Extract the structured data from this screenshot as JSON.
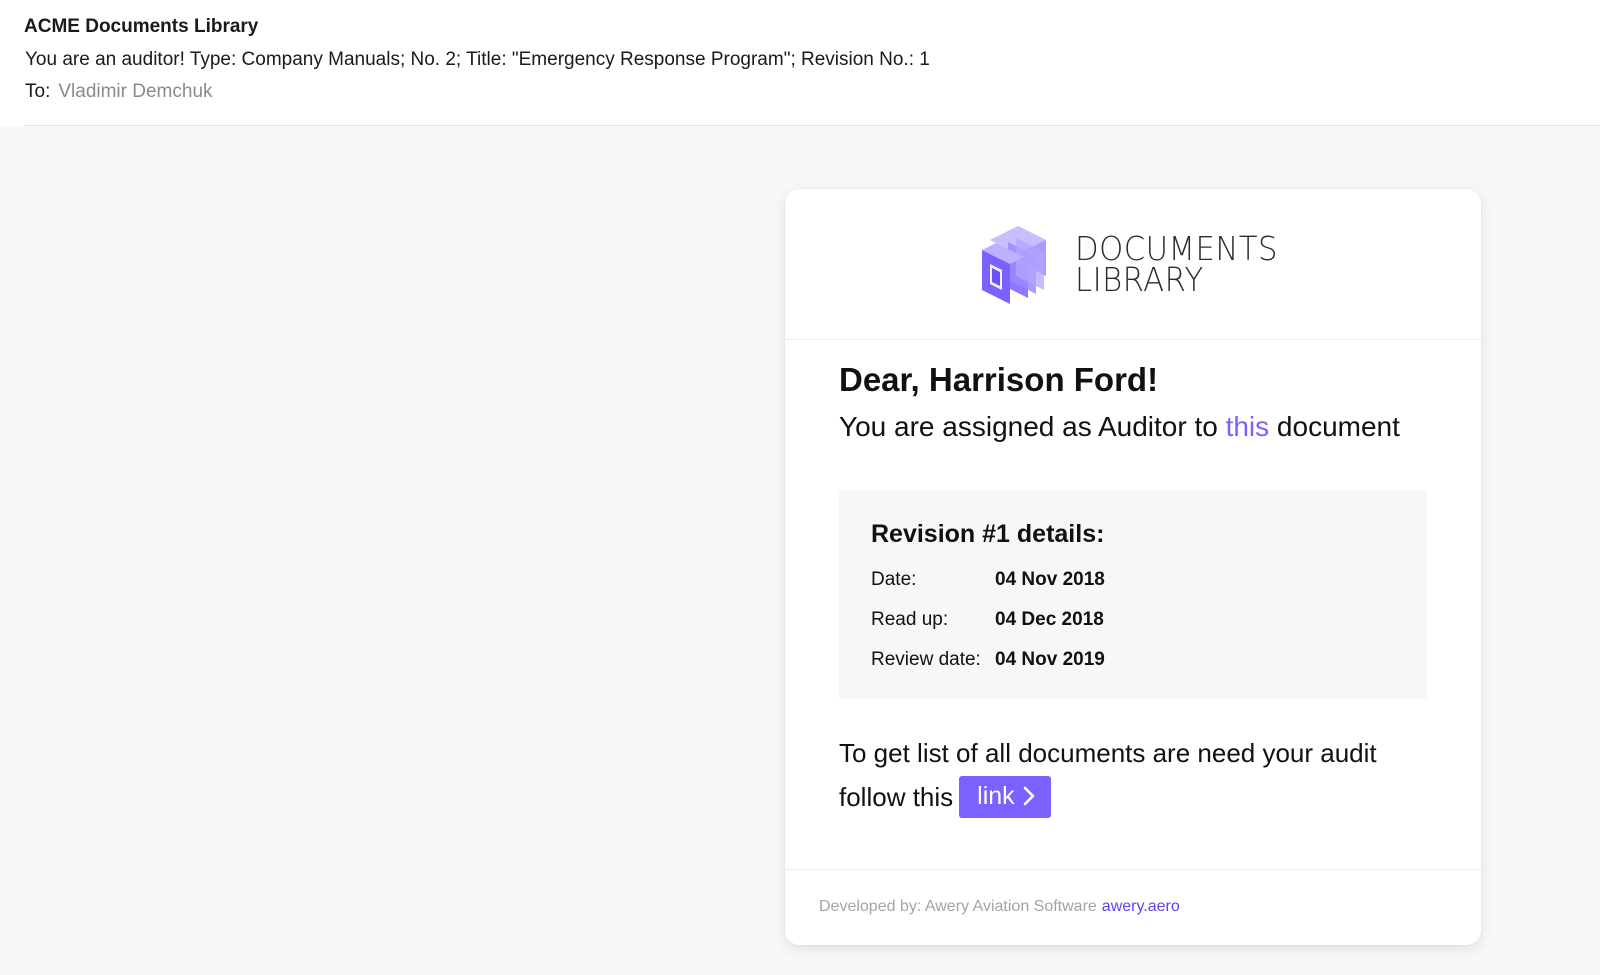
{
  "email": {
    "from": "ACME Documents Library",
    "subject": "You are an auditor! Type: Company Manuals; No. 2; Title: \"Emergency Response Program\"; Revision No.: 1",
    "to_label": "To:",
    "to_name": "Vladimir Demchuk"
  },
  "logo": {
    "line1": "DOCUMENTS",
    "line2": "LIBRARY",
    "icon": "cube-logo-icon"
  },
  "message": {
    "greeting": "Dear, Harrison Ford!",
    "assigned_before": "You are assigned as Auditor to ",
    "assigned_link": "this",
    "assigned_after": " document"
  },
  "revision": {
    "title": "Revision #1 details:",
    "rows": [
      {
        "label": "Date:",
        "value": "04 Nov 2018"
      },
      {
        "label": "Read up:",
        "value": "04 Dec 2018"
      },
      {
        "label": "Review date:",
        "value": "04 Nov 2019"
      }
    ]
  },
  "audit": {
    "line1": "To get list of all documents are need your audit",
    "line2": "follow this",
    "button_label": "link",
    "button_icon": "chevron-right-icon"
  },
  "footer": {
    "developed_by": "Developed by: Awery Aviation Software",
    "site": "awery.aero"
  },
  "colors": {
    "accent": "#7b61ff",
    "page_bg": "#f7f8fa",
    "card_bg": "#ffffff"
  }
}
